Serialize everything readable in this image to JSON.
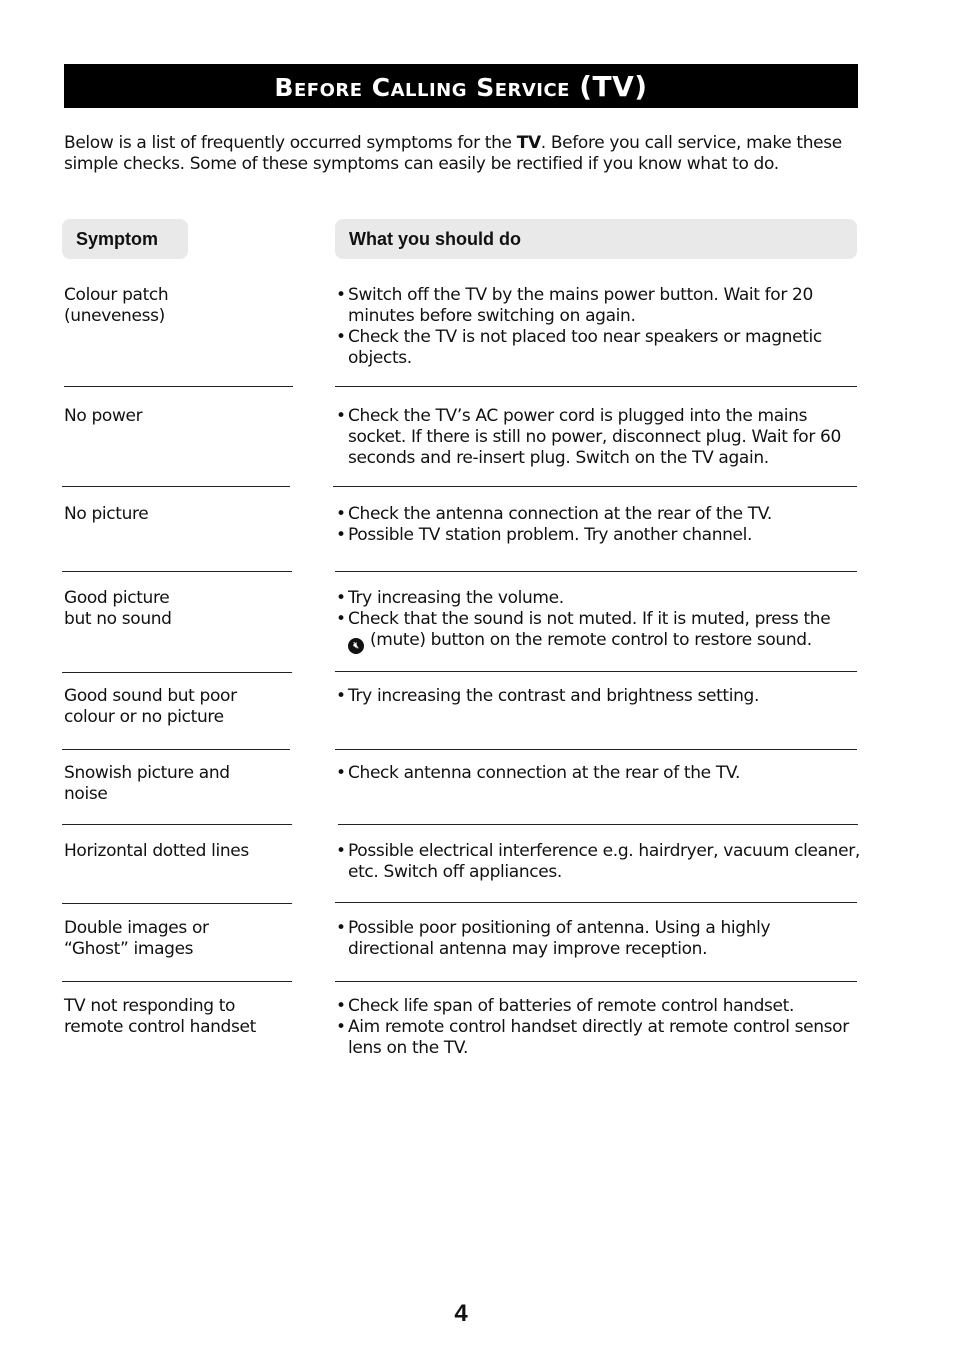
{
  "title": {
    "main": "Before Calling Service",
    "suffix": "(TV)"
  },
  "intro": {
    "before": "Below is a list of frequently occurred symptoms for the ",
    "bold": "TV",
    "after": ". Before you call service, make these simple checks. Some of these symptoms can easily be rectified if you know what to do."
  },
  "headers": {
    "symptom": "Symptom",
    "action": "What you should do"
  },
  "rows": [
    {
      "symptom": [
        "Colour patch",
        "(uneveness)"
      ],
      "actions": [
        "Switch off the TV by the mains power button. Wait for 20 minutes before switching on again.",
        "Check the TV is not placed too near speakers or magnetic objects."
      ]
    },
    {
      "symptom": [
        "No power"
      ],
      "actions": [
        "Check the TV’s AC power cord is plugged into the mains socket. If there is still no power, disconnect plug. Wait for 60 seconds and re-insert plug. Switch on the TV again."
      ]
    },
    {
      "symptom": [
        "No picture"
      ],
      "actions": [
        "Check the antenna connection at the rear of the TV.",
        "Possible TV station problem. Try another channel."
      ]
    },
    {
      "symptom": [
        "Good picture",
        "but no sound"
      ],
      "actions": [
        "Try increasing the volume.",
        "Check that the sound is not muted. If it is muted, press the"
      ],
      "mute_line": "(mute) button on the remote control to restore sound.",
      "mute_icon": "mute-icon"
    },
    {
      "symptom": [
        "Good sound but poor",
        "colour or no picture"
      ],
      "actions": [
        "Try increasing the contrast and brightness setting."
      ]
    },
    {
      "symptom": [
        "Snowish picture and",
        "noise"
      ],
      "actions": [
        "Check antenna connection at the rear of the TV."
      ]
    },
    {
      "symptom": [
        "Horizontal dotted lines"
      ],
      "actions": [
        "Possible electrical interference e.g. hairdryer, vacuum cleaner, etc. Switch off appliances."
      ]
    },
    {
      "symptom": [
        "Double images or",
        "“Ghost” images"
      ],
      "actions": [
        "Possible poor positioning of antenna. Using a highly directional antenna may improve reception."
      ]
    },
    {
      "symptom": [
        "TV not responding to",
        "remote control handset"
      ],
      "actions": [
        "Check life span of batteries of remote control handset.",
        "Aim remote control handset directly at remote control sensor lens on the TV."
      ]
    }
  ],
  "page_number": "4"
}
